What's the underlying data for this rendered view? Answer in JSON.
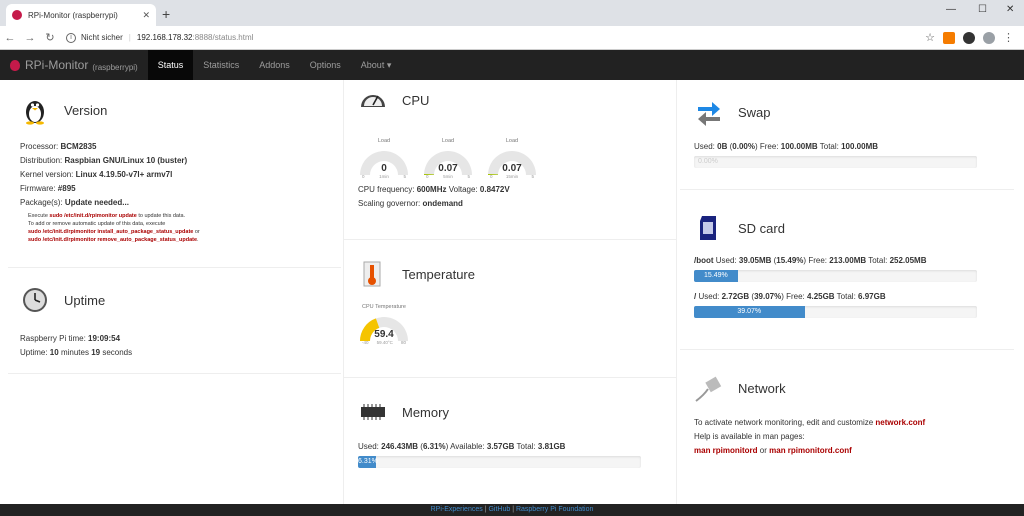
{
  "browser": {
    "tab_title": "RPi-Monitor (raspberrypi)",
    "new_tab": "+",
    "security_label": "Nicht sicher",
    "url_host": "192.168.178.32",
    "url_path": ":8888/status.html"
  },
  "navbar": {
    "brand": "RPi-Monitor",
    "brand_sub": "(raspberrypi)",
    "items": [
      "Status",
      "Statistics",
      "Addons",
      "Options",
      "About ▾"
    ]
  },
  "version": {
    "title": "Version",
    "processor_label": "Processor:",
    "processor": "BCM2835",
    "distribution_label": "Distribution:",
    "distribution": "Raspbian GNU/Linux 10 (buster)",
    "kernel_label": "Kernel version:",
    "kernel": "Linux 4.19.50-v7l+ armv7l",
    "firmware_label": "Firmware:",
    "firmware": "#895",
    "packages_label": "Package(s):",
    "packages": "Update needed...",
    "note1_a": "Execute ",
    "note1_cmd": "sudo /etc/init.d/rpimonitor update",
    "note1_b": " to update this data.",
    "note2": "To add or remove automatic update of this data, execute",
    "note3_cmd": "sudo /etc/init.d/rpimonitor install_auto_package_status_update",
    "note3_b": " or",
    "note4_cmd": "sudo /etc/init.d/rpimonitor remove_auto_package_status_update",
    "note4_b": "."
  },
  "uptime": {
    "title": "Uptime",
    "time_label": "Raspberry Pi time:",
    "time": "19:09:54",
    "uptime_label": "Uptime:",
    "uptime_min": "10",
    "uptime_min_label": "minutes",
    "uptime_sec": "19",
    "uptime_sec_label": "seconds"
  },
  "cpu": {
    "title": "CPU",
    "gauges": [
      {
        "title": "Load",
        "value": "0",
        "fraction": 0.0,
        "min": "0",
        "sub": "1min",
        "max": "5"
      },
      {
        "title": "Load",
        "value": "0.07",
        "fraction": 0.014,
        "min": "0",
        "sub": "5min",
        "max": "5"
      },
      {
        "title": "Load",
        "value": "0.07",
        "fraction": 0.014,
        "min": "0",
        "sub": "15min",
        "max": "5"
      }
    ],
    "freq_label": "CPU frequency:",
    "freq": "600MHz",
    "voltage_label": "Voltage:",
    "voltage": "0.8472V",
    "governor_label": "Scaling governor:",
    "governor": "ondemand"
  },
  "temperature": {
    "title": "Temperature",
    "gauge_title": "CPU Temperature",
    "value": "59.4",
    "fraction": 0.39,
    "min": "-40",
    "sub": "59.40°C",
    "max": "80"
  },
  "memory": {
    "title": "Memory",
    "used_label": "Used:",
    "used": "246.43MB",
    "used_pct": "6.31%",
    "available_label": "Available:",
    "available": "3.57GB",
    "total_label": "Total:",
    "total": "3.81GB",
    "bar_label": "6.31%",
    "bar_fraction": 0.0631
  },
  "swap": {
    "title": "Swap",
    "used_label": "Used:",
    "used": "0B",
    "used_pct": "0.00%",
    "free_label": "Free:",
    "free": "100.00MB",
    "total_label": "Total:",
    "total": "100.00MB",
    "bar_label": "0.00%",
    "bar_fraction": 0.0
  },
  "sdcard": {
    "title": "SD card",
    "boot_mount": "/boot",
    "boot_used": "39.05MB",
    "boot_pct": "15.49%",
    "boot_free": "213.00MB",
    "boot_total": "252.05MB",
    "boot_bar_label": "15.49%",
    "boot_fraction": 0.1549,
    "root_mount": "/",
    "root_used": "2.72GB",
    "root_pct": "39.07%",
    "root_free": "4.25GB",
    "root_total": "6.97GB",
    "root_bar_label": "39.07%",
    "root_fraction": 0.3907,
    "used_label": "Used:",
    "free_label": "Free:",
    "total_label": "Total:"
  },
  "network": {
    "title": "Network",
    "line1": "To activate network monitoring, edit and customize ",
    "line1_link": "network.conf",
    "line2": "Help is available in man pages:",
    "man1": "man rpimonitord",
    "or": " or ",
    "man2": "man rpimonitord.conf"
  },
  "footer": {
    "link1": "RPi-Experiences",
    "sep": " | ",
    "link2": "GitHub",
    "link3": "Raspberry Pi Foundation"
  }
}
